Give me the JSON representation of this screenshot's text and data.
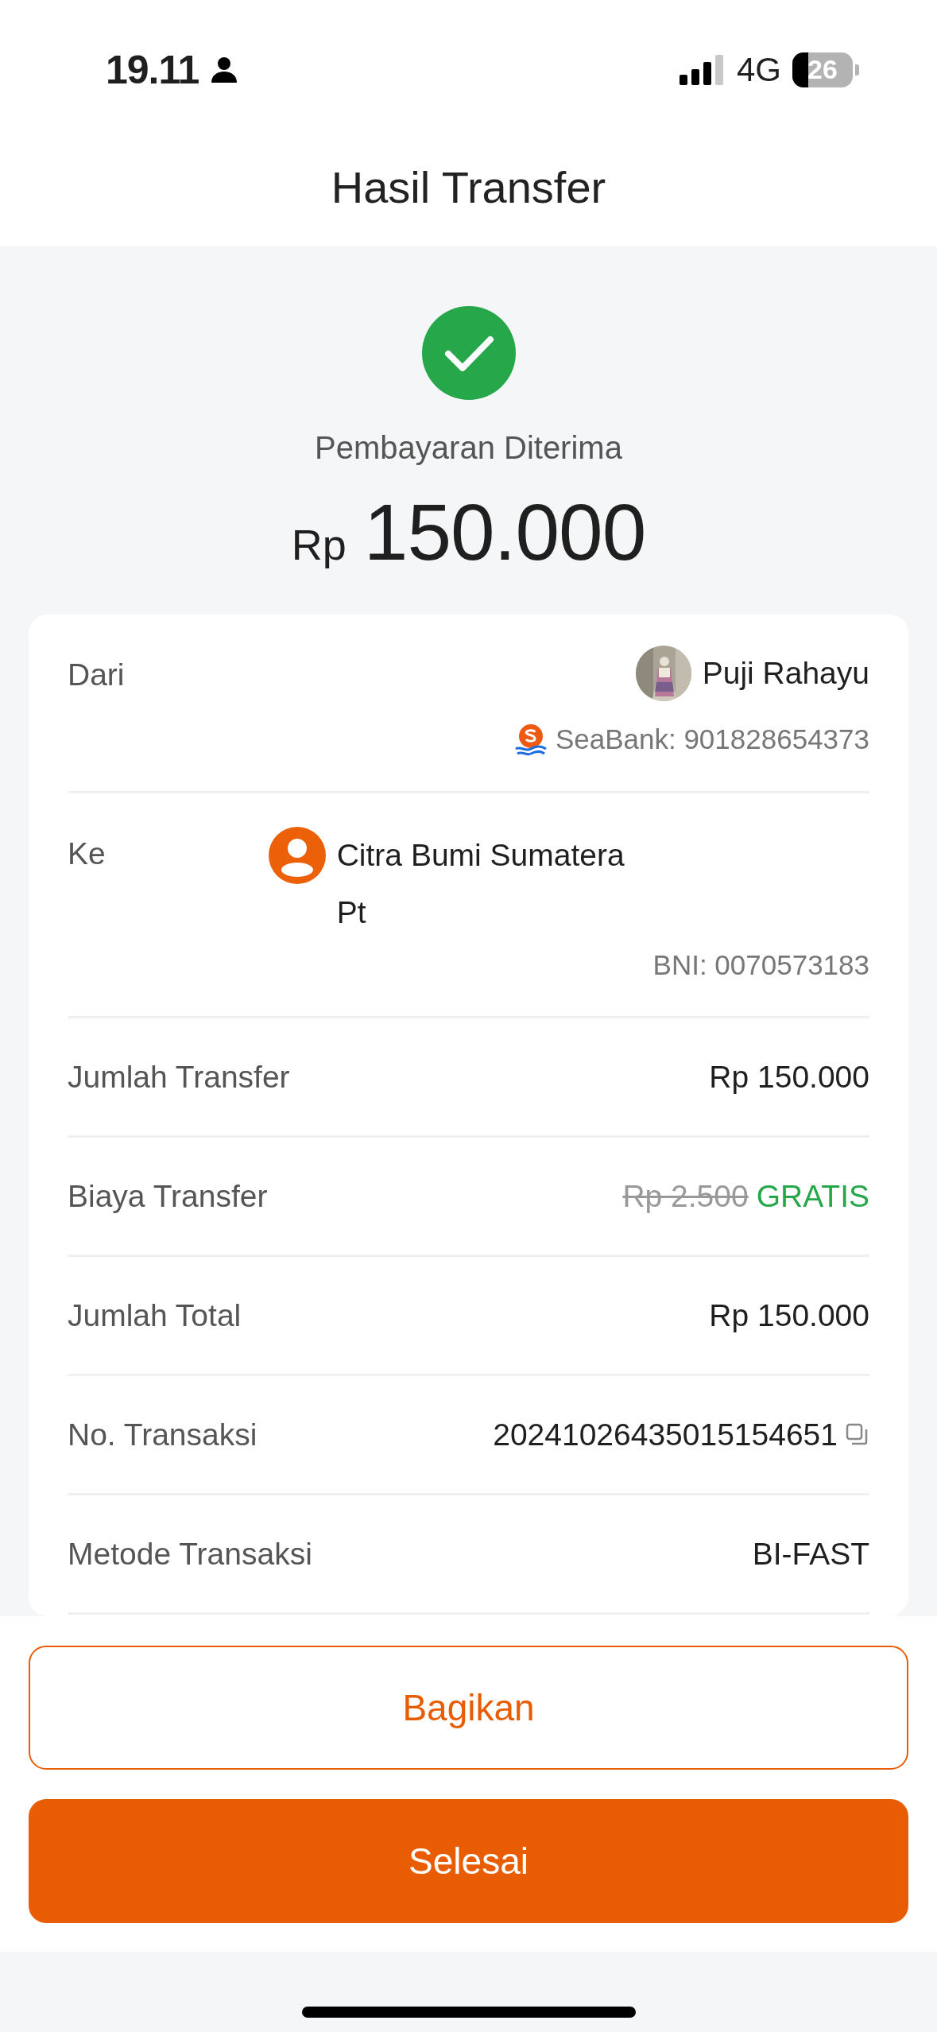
{
  "status_bar": {
    "time": "19.11",
    "network": "4G",
    "battery": "26"
  },
  "header": {
    "title": "Hasil Transfer"
  },
  "summary": {
    "status": "Pembayaran Diterima",
    "currency": "Rp",
    "amount": "150.000"
  },
  "details": [
    {
      "kind": "sender",
      "label": "Dari",
      "name": "Puji Rahayu",
      "account": "SeaBank: 901828654373"
    },
    {
      "kind": "recipient",
      "label": "Ke",
      "name": "Citra Bumi Sumatera Pt",
      "account": "BNI: 0070573183"
    },
    {
      "kind": "text",
      "label": "Jumlah Transfer",
      "value": "Rp 150.000"
    },
    {
      "kind": "fee",
      "label": "Biaya Transfer",
      "original": "Rp 2.500",
      "value": "GRATIS"
    },
    {
      "kind": "text",
      "label": "Jumlah Total",
      "value": "Rp 150.000"
    },
    {
      "kind": "copyable",
      "label": "No. Transaksi",
      "value": "20241026435015154651"
    },
    {
      "kind": "text",
      "label": "Metode Transaksi",
      "value": "BI-FAST"
    }
  ],
  "actions": [
    {
      "kind": "outline",
      "label": "Bagikan"
    },
    {
      "kind": "filled",
      "label": "Selesai"
    }
  ]
}
